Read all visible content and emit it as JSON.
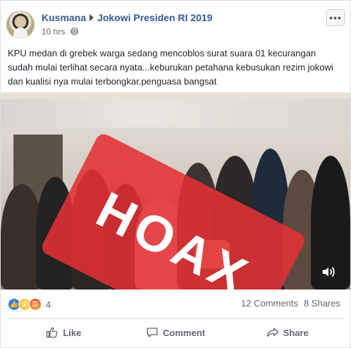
{
  "post": {
    "author": "Kusmana",
    "group": "Jokowi Presiden RI 2019",
    "time": "10 hrs",
    "text": "KPU medan di grebek warga sedang mencoblos surat suara 01 kecurangan sudah mulai terlihat secara nyata...keburukan petahana kebusukan rezim jokowi dan kualisi nya mulai terbongkar.penguasa bangsat"
  },
  "media": {
    "overlay_label": "HOAX"
  },
  "engagement": {
    "reaction_count": "4",
    "comments": "12 Comments",
    "shares": "8 Shares"
  },
  "actions": {
    "like": "Like",
    "comment": "Comment",
    "share": "Share"
  },
  "colors": {
    "link": "#365899",
    "hoax_overlay": "#e33034"
  }
}
